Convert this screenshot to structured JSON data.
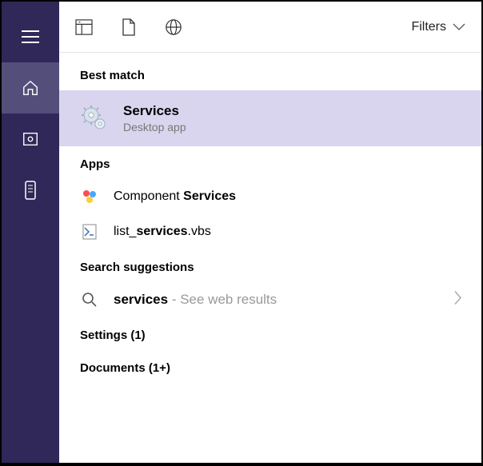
{
  "sidebar": {
    "items": [
      {
        "name": "menu"
      },
      {
        "name": "home"
      },
      {
        "name": "photos"
      },
      {
        "name": "remote"
      }
    ]
  },
  "topbar": {
    "filters_label": "Filters"
  },
  "sections": {
    "best_match": "Best match",
    "apps": "Apps",
    "search_suggestions": "Search suggestions",
    "settings": "Settings (1)",
    "documents": "Documents (1+)"
  },
  "best_match": {
    "title": "Services",
    "subtitle": "Desktop app"
  },
  "apps": [
    {
      "prefix": "Component ",
      "bold": "Services",
      "suffix": ""
    },
    {
      "prefix": "list_",
      "bold": "services",
      "suffix": ".vbs"
    }
  ],
  "suggestion": {
    "query": "services",
    "hint": "See web results"
  }
}
